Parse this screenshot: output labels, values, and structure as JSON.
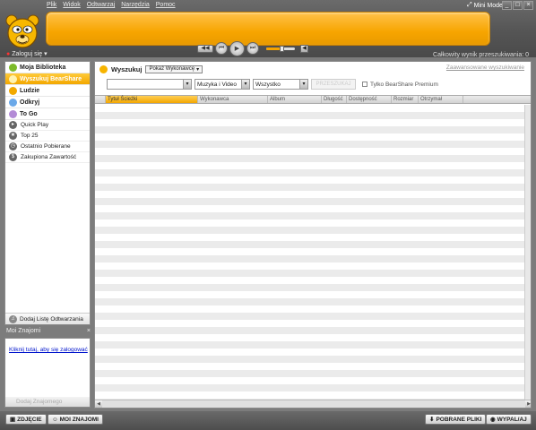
{
  "menu": [
    "Plik",
    "Widok",
    "Odtwarzaj",
    "Narzędzia",
    "Pomoc"
  ],
  "window": {
    "mini_mode": "Mini Mode",
    "minimize": "_",
    "maximize": "□",
    "close": "×"
  },
  "player": {
    "prev": "◀◀",
    "next": "▶▶",
    "back": "⏮",
    "play": "▶",
    "forward": "⏭",
    "volume": 0.55,
    "mute": "◀"
  },
  "header": {
    "login": "Zaloguj się",
    "total_results": "Całkowity wynik przeszukiwania: 0"
  },
  "sidebar": {
    "items": [
      {
        "label": "Moja Biblioteka",
        "color": "#7dbb2a"
      },
      {
        "label": "Wyszukuj BearShare",
        "color": "#f7b400"
      },
      {
        "label": "Ludzie",
        "color": "#f2a900"
      },
      {
        "label": "Odkryj",
        "color": "#6aa8e8"
      },
      {
        "label": "To Go",
        "color": "#b38bd6"
      }
    ],
    "sub_items": [
      "Quick Play",
      "Top 25",
      "Ostatnio Pobierane",
      "Zakupiona Zawartość"
    ],
    "add_playlist": "Dodaj Listę Odtwarzania"
  },
  "friends": {
    "title": "Moi Znajomi",
    "close": "×",
    "login_link": "Kliknij tutaj, aby się zalogować",
    "add_friend": "Dodaj Znajomego"
  },
  "search": {
    "title": "Wyszukuj",
    "mode": "Pokaż Wykonawcę",
    "advanced": "Zaawansowane wyszukiwanie",
    "query": "",
    "type": "Muzyka i Video",
    "filter": "Wszystko",
    "button": "PRZESZUKAJ",
    "premium": "Tylko BearShare Premium"
  },
  "table": {
    "columns": [
      "Tytuł Ścieżki",
      "Wykonawca",
      "Album",
      "Długość",
      "Dostępność",
      "Rozmiar",
      "Otrzymał"
    ]
  },
  "bottom": {
    "photo": "ZDJĘCIE",
    "friends": "MOI ZNAJOMI",
    "downloads": "POBRANE PLIKI",
    "upload": "WYPAL/AJ"
  }
}
